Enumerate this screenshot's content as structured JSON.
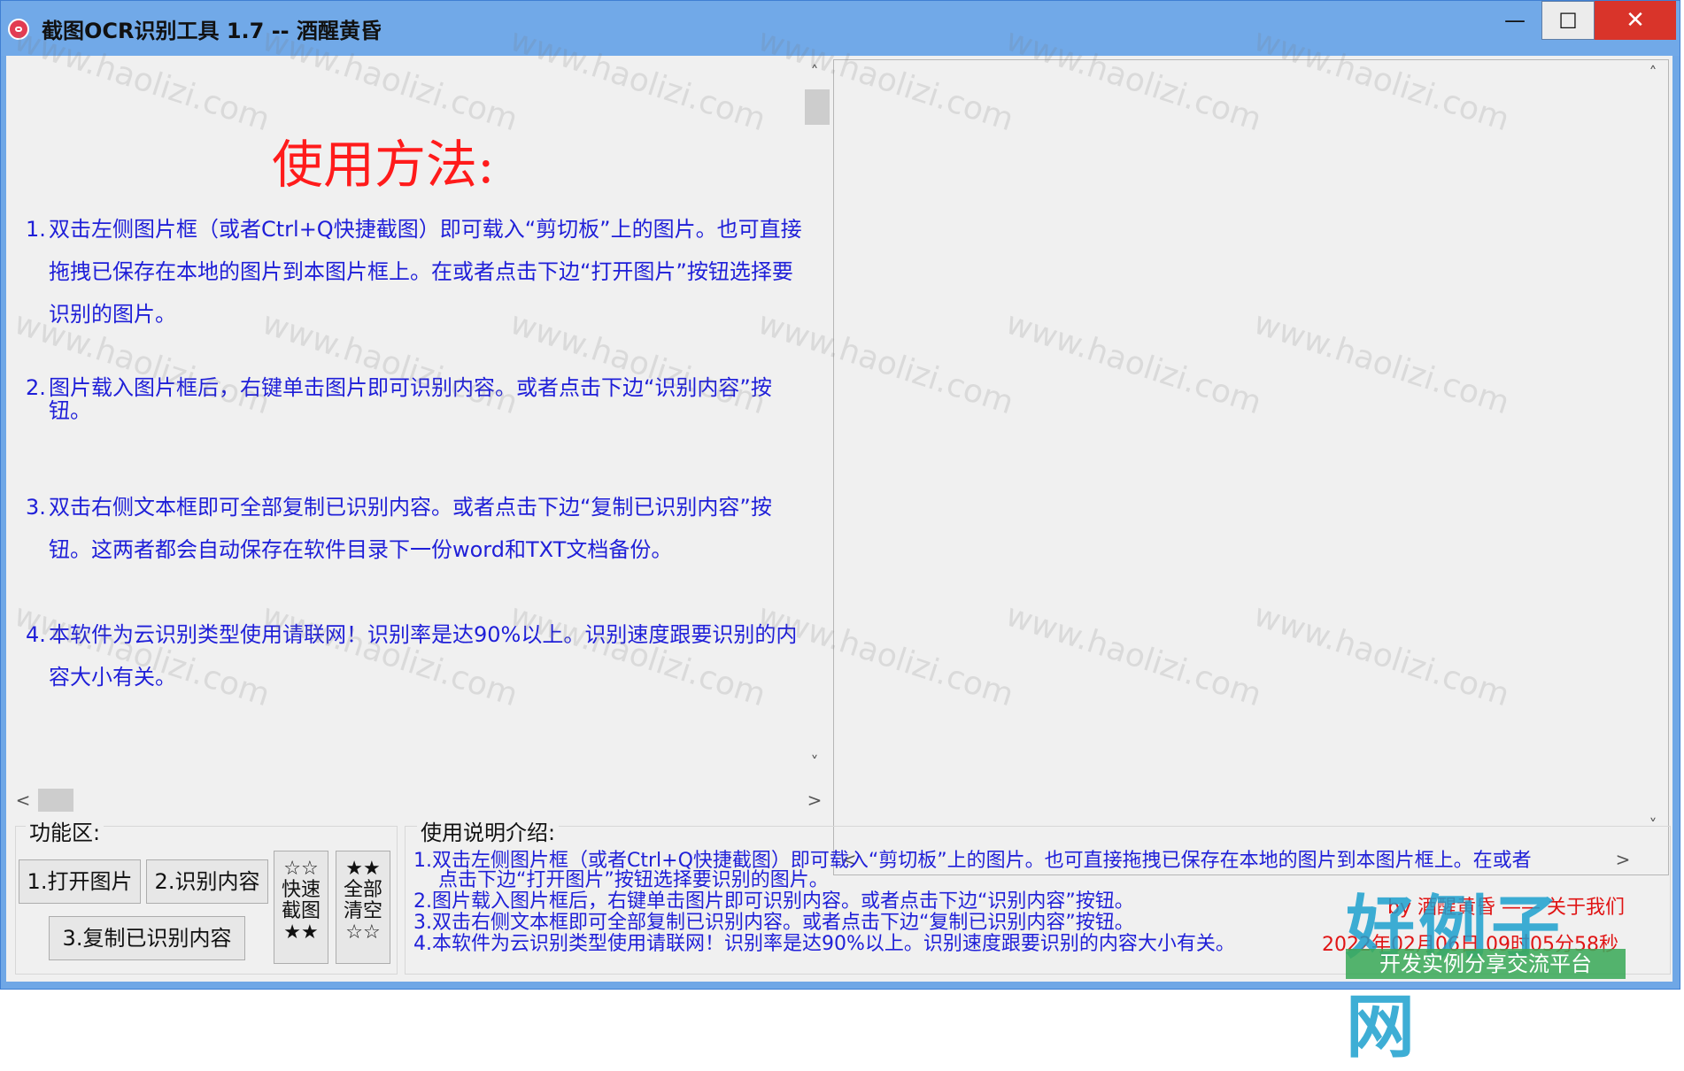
{
  "window": {
    "title": "截图OCR识别工具 1.7 -- 酒醒黄昏",
    "min_glyph": "—",
    "max_glyph": "☐",
    "close_glyph": "✕"
  },
  "help": {
    "heading": "使用方法:",
    "items": [
      {
        "num": "1.",
        "text": "双击左侧图片框（或者Ctrl+Q快捷截图）即可载入“剪切板”上的图片。也可直接拖拽已保存在本地的图片到本图片框上。在或者点击下边“打开图片”按钮选择要识别的图片。"
      },
      {
        "num": "2.",
        "text": "图片载入图片框后，右键单击图片即可识别内容。或者点击下边“识别内容”按钮。"
      },
      {
        "num": "3.",
        "text": "双击右侧文本框即可全部复制已识别内容。或者点击下边“复制已识别内容”按钮。这两者都会自动保存在软件目录下一份word和TXT文档备份。"
      },
      {
        "num": "4.",
        "text": "本软件为云识别类型使用请联网！识别率是达90%以上。识别速度跟要识别的内容大小有关。"
      }
    ]
  },
  "scroll": {
    "up": "˄",
    "down": "˅",
    "left": "<",
    "right": ">"
  },
  "func_area": {
    "label": "功能区:",
    "open_image": "1.打开图片",
    "recognize": "2.识别内容",
    "copy_recognized": "3.复制已识别内容",
    "quick_capture": [
      "☆☆",
      "快速",
      "截图",
      "★★"
    ],
    "clear_all": [
      "★★",
      "全部",
      "清空",
      "☆☆"
    ]
  },
  "desc_area": {
    "label": "使用说明介绍:",
    "lines": [
      "1.双击左侧图片框（或者Ctrl+Q快捷截图）即可载入“剪切板”上的图片。也可直接拖拽已保存在本地的图片到本图片框上。在或者",
      "点击下边“打开图片”按钮选择要识别的图片。",
      "2.图片载入图片框后，右键单击图片即可识别内容。或者点击下边“识别内容”按钮。",
      "3.双击右侧文本框即可全部复制已识别内容。或者点击下边“复制已识别内容”按钮。",
      "4.本软件为云识别类型使用请联网！识别率是达90%以上。识别速度跟要识别的内容大小有关。"
    ],
    "credit_top": "by 酒醒黄昏 —— 关于我们",
    "timestamp": "2022年02月06日 09时05分58秒"
  },
  "watermark": {
    "text": "www.haolizi.com"
  },
  "logo": {
    "big": "好例子网",
    "sub": "开发实例分享交流平台"
  },
  "colors": {
    "help_text": "#1f1fd8",
    "heading": "#ff1b1b",
    "title_bar": "#71a9e8",
    "close": "#d9342a"
  }
}
